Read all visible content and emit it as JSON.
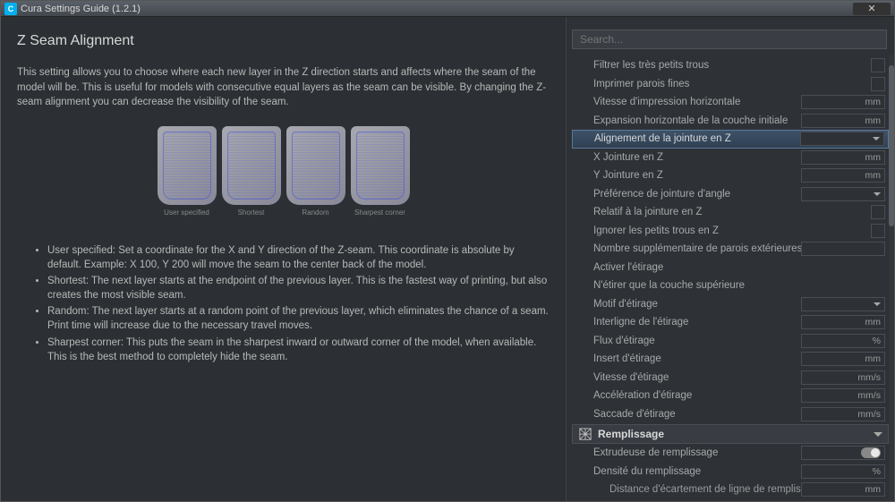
{
  "titlebar": {
    "icon_letter": "C",
    "title": "Cura Settings Guide (1.2.1)"
  },
  "article": {
    "title": "Z Seam Alignment",
    "description": "This setting allows you to choose where each new layer in the Z direction starts and affects where the seam of the model will be. This is useful for models with consecutive equal layers as the seam can be visible. By changing the Z-seam alignment you can decrease the visibility of the seam.",
    "thumbs": [
      {
        "label": "User specified"
      },
      {
        "label": "Shortest"
      },
      {
        "label": "Random"
      },
      {
        "label": "Sharpest corner"
      }
    ],
    "bullets": [
      "User specified: Set a coordinate for the X and Y direction of the Z-seam. This coordinate is absolute by default. Example: X 100, Y 200 will move the seam to the center back of the model.",
      "Shortest: The next layer starts at the endpoint of the previous layer. This is the fastest way of printing, but also creates the most visible seam.",
      "Random: The next layer starts at a random point of the previous layer, which eliminates the chance of a seam. Print time will increase due to the necessary travel moves.",
      "Sharpest corner: This puts the seam in the sharpest inward or outward corner of the model, when available. This is the best method to completely hide the seam."
    ]
  },
  "search": {
    "placeholder": "Search..."
  },
  "settings": [
    {
      "label": "Filtrer les très petits trous",
      "type": "empty"
    },
    {
      "label": "Imprimer parois fines",
      "type": "empty"
    },
    {
      "label": "Vitesse d'impression horizontale",
      "type": "unit",
      "unit": "mm"
    },
    {
      "label": "Expansion horizontale de la couche initiale",
      "type": "unit",
      "unit": "mm"
    },
    {
      "label": "Alignement de la jointure en Z",
      "type": "dropdown",
      "selected": true
    },
    {
      "label": "X Jointure en Z",
      "type": "unit",
      "unit": "mm"
    },
    {
      "label": "Y Jointure en Z",
      "type": "unit",
      "unit": "mm"
    },
    {
      "label": "Préférence de jointure d'angle",
      "type": "dropdown"
    },
    {
      "label": "Relatif à la jointure en Z",
      "type": "empty"
    },
    {
      "label": "Ignorer les petits trous en Z",
      "type": "empty"
    },
    {
      "label": "Nombre supplémentaire de parois extérieures",
      "type": "text"
    },
    {
      "label": "Activer l'étirage",
      "type": "none"
    },
    {
      "label": "N'étirer que la couche supérieure",
      "type": "none"
    },
    {
      "label": "Motif d'étirage",
      "type": "dropdown"
    },
    {
      "label": "Interligne de l'étirage",
      "type": "unit",
      "unit": "mm"
    },
    {
      "label": "Flux d'étirage",
      "type": "unit",
      "unit": "%"
    },
    {
      "label": "Insert d'étirage",
      "type": "unit",
      "unit": "mm"
    },
    {
      "label": "Vitesse d'étirage",
      "type": "unit",
      "unit": "mm/s"
    },
    {
      "label": "Accélération d'étirage",
      "type": "unit",
      "unit": "mm/s"
    },
    {
      "label": "Saccade d'étirage",
      "type": "unit",
      "unit": "mm/s"
    }
  ],
  "category": {
    "label": "Remplissage"
  },
  "settings2": [
    {
      "label": "Extrudeuse de remplissage",
      "type": "toggle"
    },
    {
      "label": "Densité du remplissage",
      "type": "unit",
      "unit": "%"
    },
    {
      "label": "Distance d'écartement de ligne de remplissage",
      "type": "unit",
      "unit": "mm",
      "indent": true
    }
  ]
}
